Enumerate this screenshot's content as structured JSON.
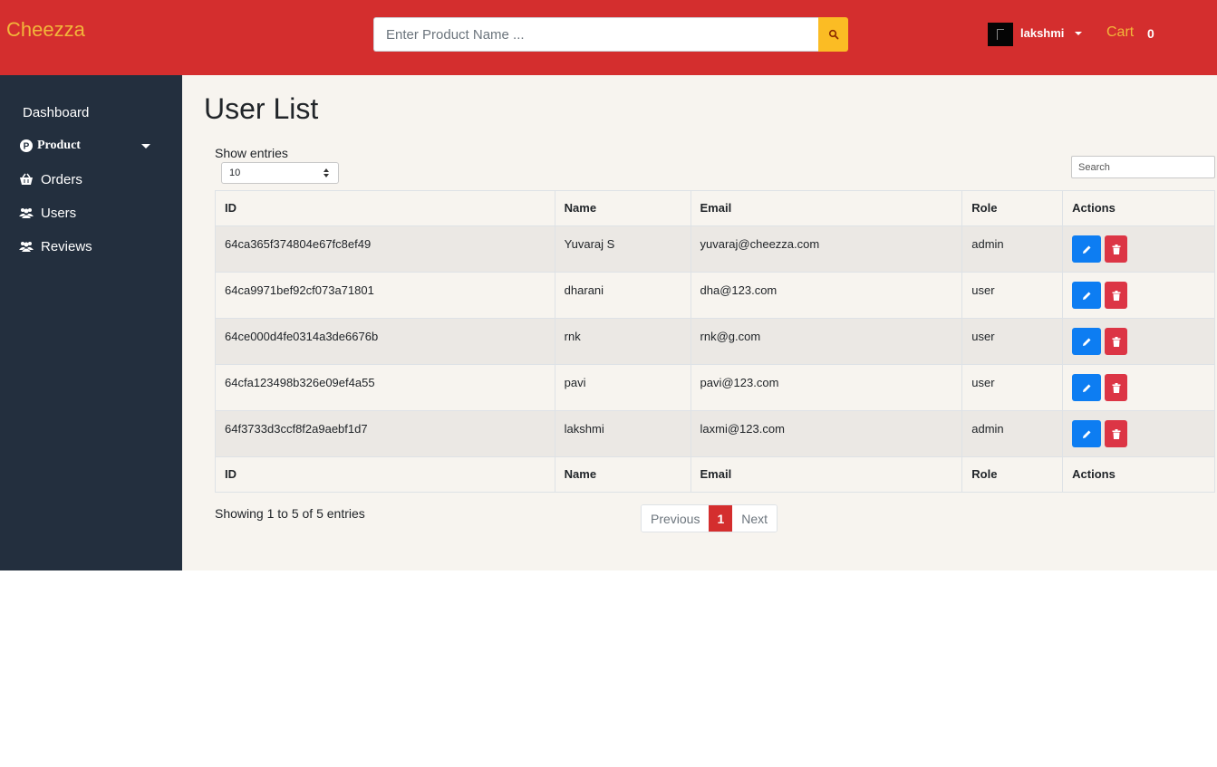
{
  "header": {
    "brand": "Cheezza",
    "search": {
      "placeholder": "Enter Product Name ..."
    },
    "user": {
      "name": "lakshmi"
    },
    "cart": {
      "label": "Cart",
      "count": "0"
    }
  },
  "sidebar": {
    "items": [
      {
        "label": "Dashboard",
        "icon": "dashboard"
      },
      {
        "label": "Product",
        "icon": "product-p-icon"
      },
      {
        "label": "Orders",
        "icon": "basket-icon"
      },
      {
        "label": "Users",
        "icon": "users-icon"
      },
      {
        "label": "Reviews",
        "icon": "users-icon"
      }
    ]
  },
  "main": {
    "title": "User List",
    "show_entries_label": "Show entries",
    "page_length": "10",
    "search_placeholder": "Search",
    "columns": [
      "ID",
      "Name",
      "Email",
      "Role",
      "Actions"
    ],
    "rows": [
      {
        "id": "64ca365f374804e67fc8ef49",
        "name": "Yuvaraj S",
        "email": "yuvaraj@cheezza.com",
        "role": "admin"
      },
      {
        "id": "64ca9971bef92cf073a71801",
        "name": "dharani",
        "email": "dha@123.com",
        "role": "user"
      },
      {
        "id": "64ce000d4fe0314a3de6676b",
        "name": "rnk",
        "email": "rnk@g.com",
        "role": "user"
      },
      {
        "id": "64cfa123498b326e09ef4a55",
        "name": "pavi",
        "email": "pavi@123.com",
        "role": "user"
      },
      {
        "id": "64f3733d3ccf8f2a9aebf1d7",
        "name": "lakshmi",
        "email": "laxmi@123.com",
        "role": "admin"
      }
    ],
    "info": "Showing 1 to 5 of 5 entries",
    "pagination": {
      "previous": "Previous",
      "current": "1",
      "next": "Next"
    }
  },
  "colors": {
    "header_bg": "#d42e2e",
    "brand": "#f2b63a",
    "search_button": "#fbbc24",
    "sidebar_bg": "#232f3e",
    "content_bg": "#f7f4ef",
    "edit_button": "#0d7df2",
    "delete_button": "#dc3545"
  }
}
